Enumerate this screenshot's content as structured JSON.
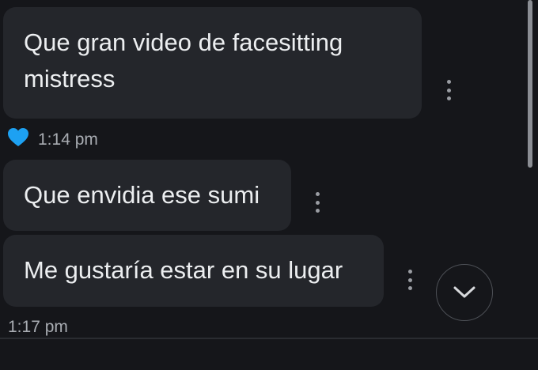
{
  "messages": [
    {
      "lines": [
        "Que gran video de facesitting",
        "mistress"
      ]
    },
    {
      "lines": [
        "Que envidia ese sumi"
      ]
    },
    {
      "lines": [
        "Me gustaría estar en su lugar"
      ]
    }
  ],
  "timestamps": {
    "first": "1:14 pm",
    "second": "1:17 pm"
  },
  "reaction": {
    "icon": "heart-icon",
    "color": "#1da1f2"
  },
  "controls": {
    "scroll_down_icon": "chevron-down-icon",
    "more_icon": "more-vertical-icon"
  }
}
